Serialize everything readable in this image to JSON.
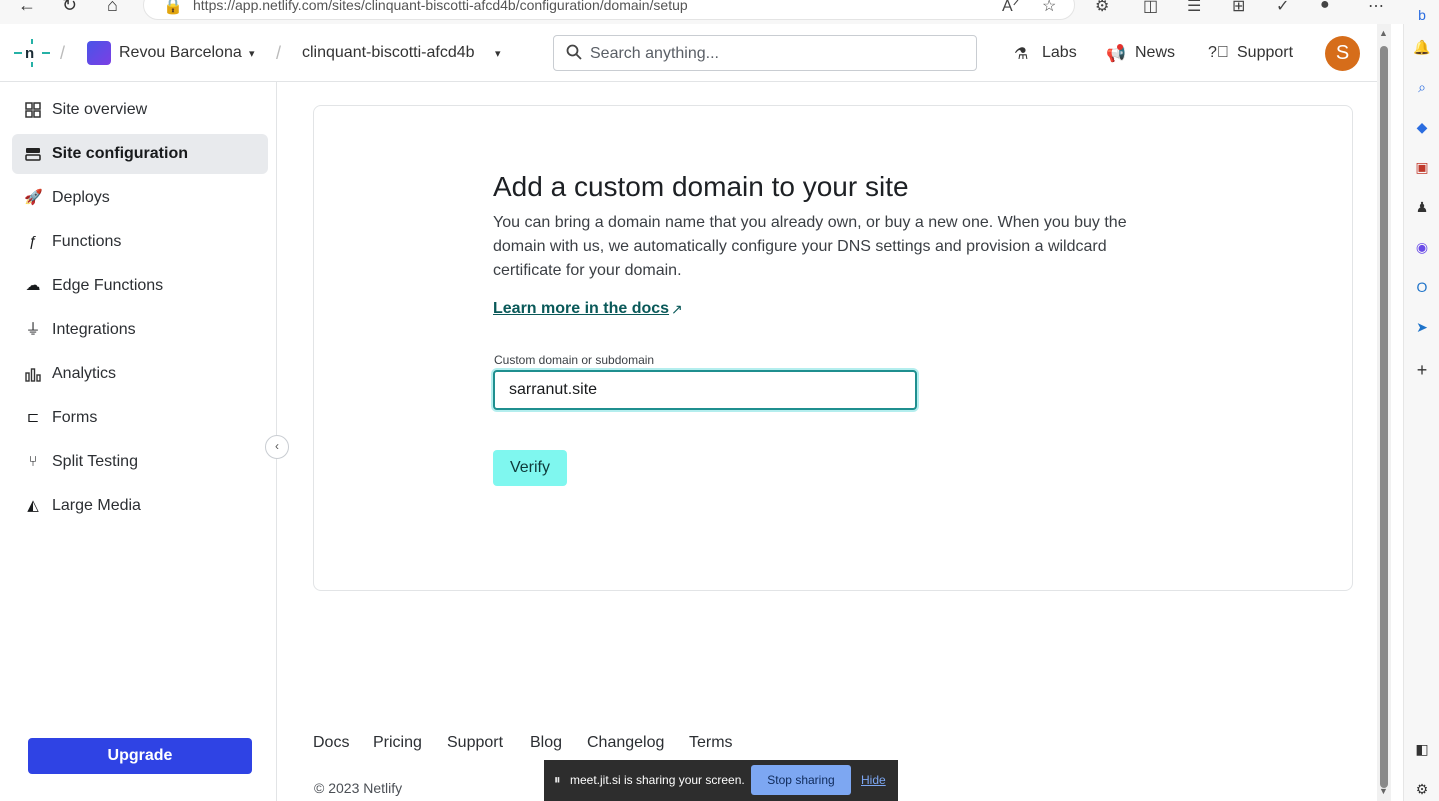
{
  "browser": {
    "url": "https://app.netlify.com/sites/clinquant-biscotti-afcd4b/configuration/domain/setup"
  },
  "header": {
    "team_name": "Revou Barcelona",
    "site_name": "clinquant-biscotti-afcd4b",
    "search_placeholder": "Search anything...",
    "labs": "Labs",
    "news": "News",
    "support": "Support",
    "avatar_initial": "S"
  },
  "sidebar": {
    "items": [
      {
        "label": "Site overview",
        "icon": "grid-icon"
      },
      {
        "label": "Site configuration",
        "icon": "config-icon",
        "active": true
      },
      {
        "label": "Deploys",
        "icon": "rocket-icon"
      },
      {
        "label": "Functions",
        "icon": "function-icon"
      },
      {
        "label": "Edge Functions",
        "icon": "edge-function-icon"
      },
      {
        "label": "Integrations",
        "icon": "plug-icon"
      },
      {
        "label": "Analytics",
        "icon": "chart-icon"
      },
      {
        "label": "Forms",
        "icon": "form-icon"
      },
      {
        "label": "Split Testing",
        "icon": "split-icon"
      },
      {
        "label": "Large Media",
        "icon": "media-icon"
      }
    ],
    "upgrade": "Upgrade"
  },
  "main": {
    "title": "Add a custom domain to your site",
    "description": "You can bring a domain name that you already own, or buy a new one. When you buy the domain with us, we automatically configure your DNS settings and provision a wildcard certificate for your domain.",
    "docs_link": "Learn more in the docs",
    "field_label": "Custom domain or subdomain",
    "field_value": "sarranut.site",
    "verify_label": "Verify"
  },
  "footer": {
    "links": [
      "Docs",
      "Pricing",
      "Support",
      "Blog",
      "Changelog",
      "Terms"
    ],
    "copyright": "© 2023 Netlify"
  },
  "share_bar": {
    "text": "meet.jit.si is sharing your screen.",
    "stop": "Stop sharing",
    "hide": "Hide"
  },
  "colors": {
    "brand_teal": "#1f8f8f",
    "upgrade_blue": "#2f43e4",
    "verify_bg": "#7ff7ef",
    "avatar_orange": "#d66d1a"
  }
}
